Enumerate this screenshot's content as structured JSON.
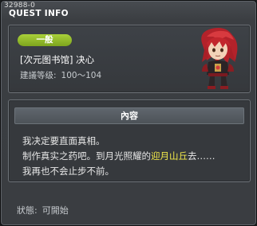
{
  "window": {
    "id_text": "32988-0",
    "title": "QUEST INFO"
  },
  "quest": {
    "category_badge": "一般",
    "name": "[次元图书馆] 决心",
    "level_label": "建議等级:",
    "level_range": "100～104",
    "character_icon": "red-haired-hero-portrait"
  },
  "content": {
    "header": "內容",
    "line1": "我决定要直面真相。",
    "line2_before": "制作真实之药吧。到月光照耀的",
    "line2_highlight": "迎月山丘",
    "line2_after": "去……",
    "line3": "我再也不会止步不前。"
  },
  "status": {
    "label": "狀態:",
    "value": "可開始"
  },
  "colors": {
    "badge_green": "#8fb825",
    "highlight_yellow": "#f2e94a",
    "window_bg": "#3a3d41"
  }
}
